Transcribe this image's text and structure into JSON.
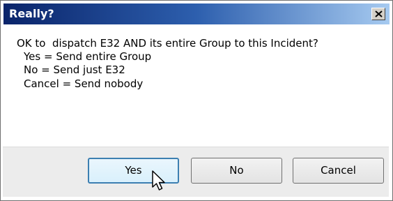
{
  "window": {
    "title": "Really?",
    "close_icon": "close-icon"
  },
  "message": {
    "line1": "OK to  dispatch E32 AND its entire Group to this Incident?",
    "line2": "Yes = Send entire Group",
    "line3": "No = Send just E32",
    "line4": "Cancel = Send nobody"
  },
  "buttons": {
    "yes": "Yes",
    "no": "No",
    "cancel": "Cancel"
  },
  "colors": {
    "titlebar_start": "#0a246a",
    "titlebar_end": "#a6caf0",
    "default_button_border": "#3c7fb1"
  },
  "cursor_icon": "arrow-pointer-icon"
}
